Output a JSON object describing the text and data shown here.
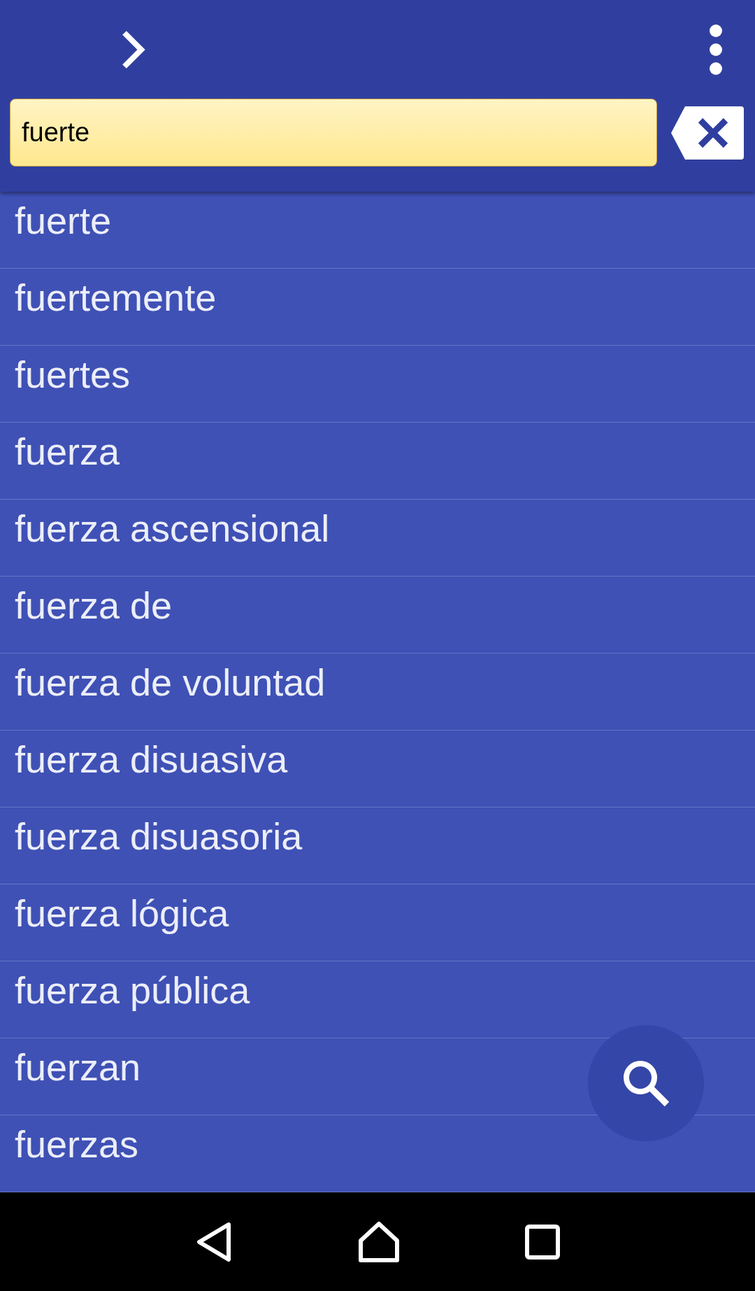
{
  "search": {
    "value": "fuerte"
  },
  "results": [
    "fuerte",
    "fuertemente",
    "fuertes",
    "fuerza",
    "fuerza ascensional",
    "fuerza de",
    "fuerza de voluntad",
    "fuerza disuasiva",
    "fuerza disuasoria",
    "fuerza lógica",
    "fuerza pública",
    "fuerzan",
    "fuerzas"
  ]
}
